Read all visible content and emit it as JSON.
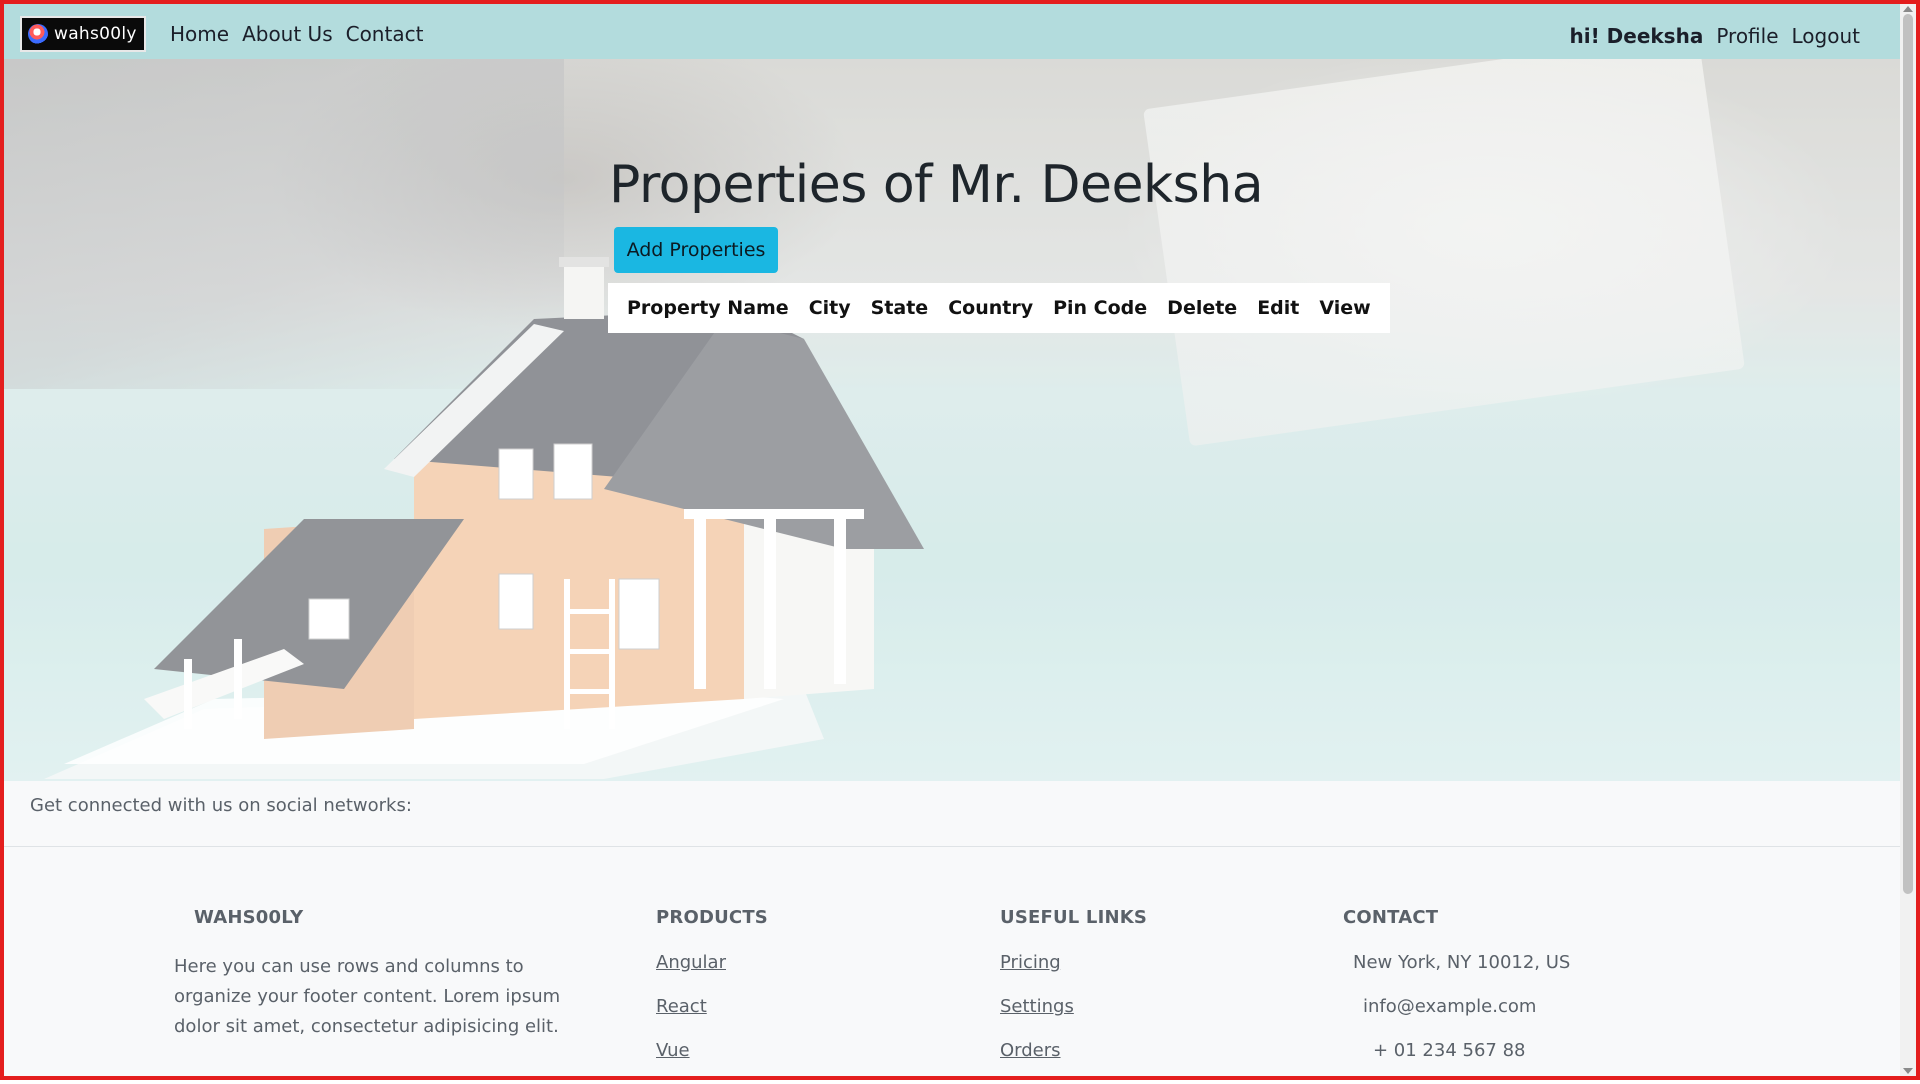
{
  "navbar": {
    "brand": "wahs00ly",
    "links": [
      "Home",
      "About Us",
      "Contact"
    ],
    "greeting": "hi! Deeksha",
    "profile": "Profile",
    "logout": "Logout"
  },
  "main": {
    "title": "Properties of Mr. Deeksha",
    "add_button": "Add Properties",
    "table_headers": [
      "Property Name",
      "City",
      "State",
      "Country",
      "Pin Code",
      "Delete",
      "Edit",
      "View"
    ]
  },
  "footer": {
    "social_text": "Get connected with us on social networks:",
    "about": {
      "title": "WAHS00LY",
      "text": "Here you can use rows and columns to organize your footer content. Lorem ipsum dolor sit amet, consectetur adipisicing elit."
    },
    "products": {
      "title": "PRODUCTS",
      "items": [
        "Angular",
        "React",
        "Vue"
      ]
    },
    "useful_links": {
      "title": "USEFUL LINKS",
      "items": [
        "Pricing",
        "Settings",
        "Orders"
      ]
    },
    "contact": {
      "title": "CONTACT",
      "items": [
        "New York, NY 10012, US",
        "info@example.com",
        "+ 01 234 567 88"
      ]
    }
  },
  "colors": {
    "navbar_bg": "#b3dcdd",
    "accent_button": "#1ab7e2",
    "frame_border": "#e41e1e"
  }
}
